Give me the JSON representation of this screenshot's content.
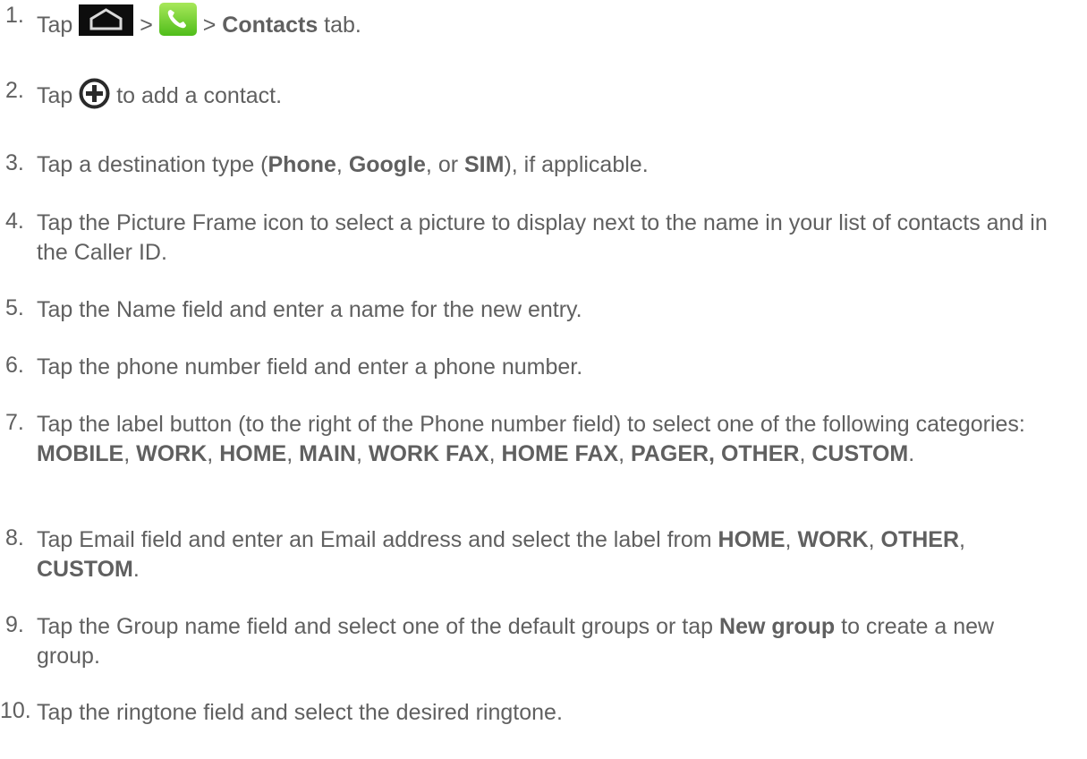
{
  "steps": [
    {
      "num": "1.",
      "parts": [
        "Tap ",
        "home-icon",
        " > ",
        "phone-icon",
        " > ",
        "**Contacts",
        " tab."
      ]
    },
    {
      "num": "2.",
      "parts": [
        "Tap ",
        "add-icon",
        " to add a contact."
      ]
    },
    {
      "num": "3.",
      "parts": [
        "Tap a destination type (",
        "**Phone",
        ", ",
        "**Google",
        ", or ",
        "**SIM",
        "), if applicable."
      ]
    },
    {
      "num": "4.",
      "parts": [
        "Tap the Picture Frame icon to select a picture to display next to the name in your list of contacts and in the Caller ID."
      ]
    },
    {
      "num": "5.",
      "parts": [
        "Tap the Name field and enter a name for the new entry."
      ]
    },
    {
      "num": "6.",
      "parts": [
        "Tap the phone number field and enter a phone number."
      ]
    },
    {
      "num": "7.",
      "parts": [
        "Tap the label button (to the right of the Phone number field) to select one of the following categories: ",
        "**MOBILE",
        ", ",
        "**WORK",
        ", ",
        "**HOME",
        ", ",
        "**MAIN",
        ", ",
        "**WORK FAX",
        ", ",
        "**HOME FAX",
        ", ",
        "**PAGER,",
        " ",
        "**OTHER",
        ", ",
        "**CUSTOM",
        "."
      ]
    },
    {
      "num": "8.",
      "parts": [
        "Tap Email field and enter an Email address and select the label from ",
        "**HOME",
        ", ",
        "**WORK",
        ", ",
        "**OTHER",
        ", ",
        "**CUSTOM",
        "."
      ]
    },
    {
      "num": "9.",
      "parts": [
        "Tap the Group name field and select one of the default groups or tap ",
        "**New group",
        " to create a new group."
      ]
    },
    {
      "num": "10.",
      "parts": [
        "Tap the ringtone field and select the desired ringtone."
      ]
    }
  ]
}
